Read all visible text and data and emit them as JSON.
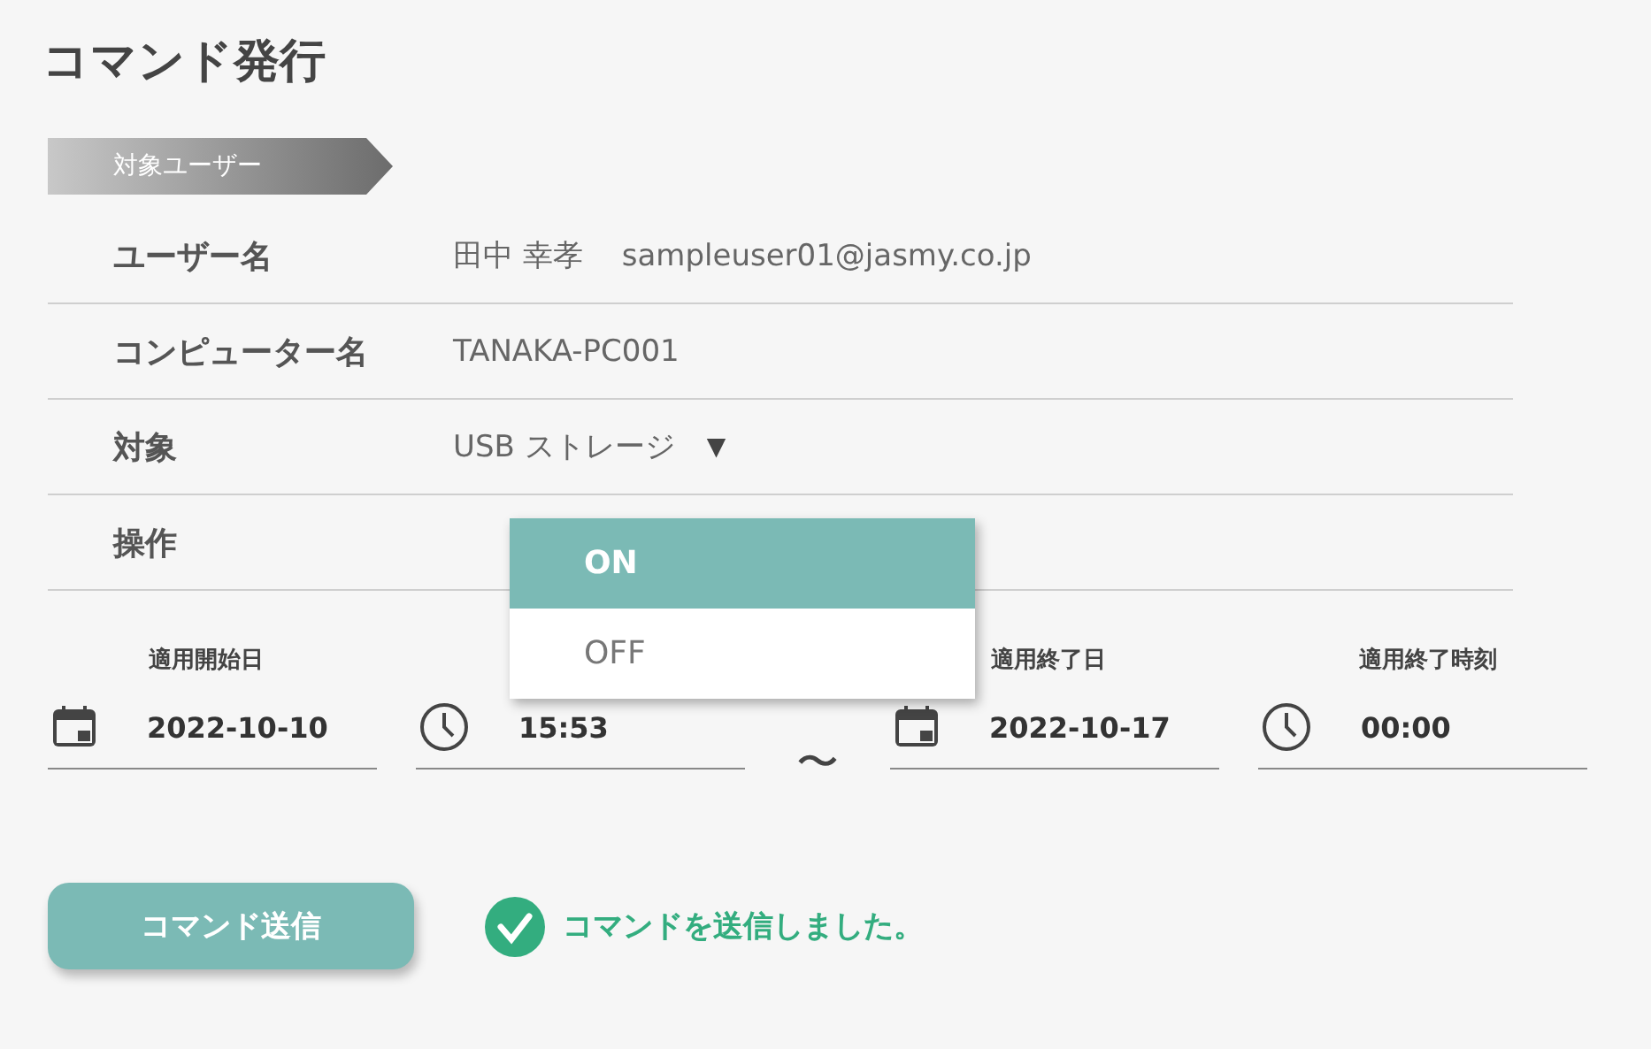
{
  "title": "コマンド発行",
  "section": {
    "label": "対象ユーザー"
  },
  "rows": [
    {
      "label": "ユーザー名",
      "values": [
        "田中 幸孝",
        "sampleuser01@jasmy.co.jp"
      ]
    },
    {
      "label": "コンピューター名",
      "values": [
        "TANAKA-PC001"
      ]
    },
    {
      "label": "対象",
      "values": [
        "USB ストレージ"
      ],
      "caret": "▼"
    },
    {
      "label": "操作",
      "values": []
    }
  ],
  "dropdown": {
    "options": [
      {
        "label": "ON",
        "selected": true
      },
      {
        "label": "OFF",
        "selected": false
      }
    ]
  },
  "period": {
    "fields": [
      {
        "kind": "date",
        "label": "適用開始日",
        "value": "2022-10-10"
      },
      {
        "kind": "time",
        "value": "15:53"
      },
      {
        "kind": "date",
        "label": "適用終了日",
        "value": "2022-10-17"
      },
      {
        "kind": "time",
        "label": "適用終了時刻",
        "value": "00:00"
      }
    ],
    "separator": "〜"
  },
  "send_button": "コマンド送信",
  "message": "コマンドを送信しました。"
}
